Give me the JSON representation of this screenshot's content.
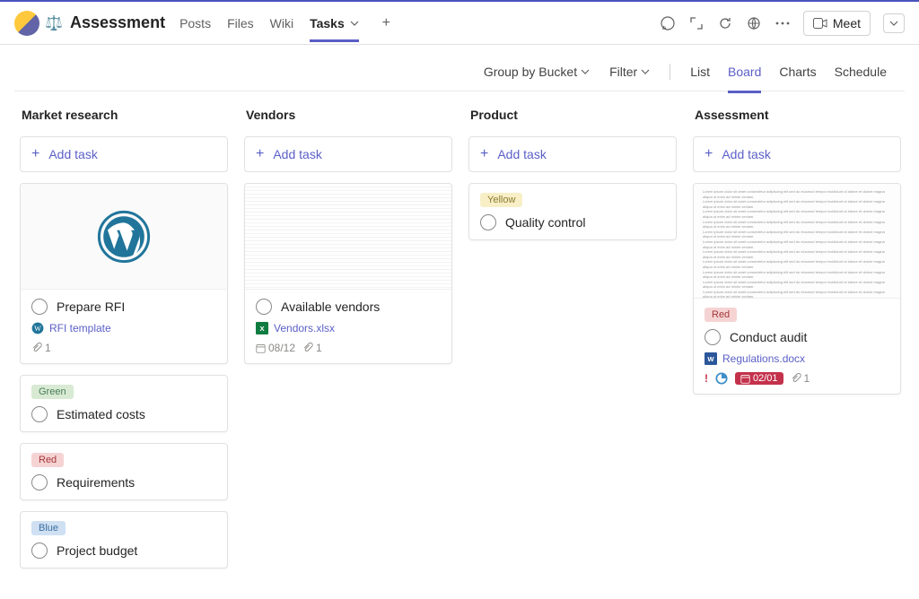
{
  "header": {
    "channel": "Assessment",
    "tabs": [
      "Posts",
      "Files",
      "Wiki",
      "Tasks"
    ],
    "active_tab": "Tasks",
    "meet_label": "Meet"
  },
  "toolbar": {
    "group_by": "Group by Bucket",
    "filter": "Filter",
    "views": [
      "List",
      "Board",
      "Charts",
      "Schedule"
    ],
    "active_view": "Board"
  },
  "columns": [
    {
      "name": "Market research",
      "add_label": "Add task",
      "cards": [
        {
          "type": "image",
          "title": "Prepare RFI",
          "attachment_name": "RFI template",
          "attachment_kind": "wordpress",
          "count": "1"
        },
        {
          "type": "label",
          "label": "Green",
          "label_class": "lbl-green",
          "title": "Estimated costs"
        },
        {
          "type": "label",
          "label": "Red",
          "label_class": "lbl-red",
          "title": "Requirements"
        },
        {
          "type": "label",
          "label": "Blue",
          "label_class": "lbl-blue",
          "title": "Project budget"
        }
      ]
    },
    {
      "name": "Vendors",
      "add_label": "Add task",
      "cards": [
        {
          "type": "placeholder",
          "title": "Available vendors",
          "attachment_name": "Vendors.xlsx",
          "attachment_kind": "excel",
          "due": "08/12",
          "count": "1"
        }
      ]
    },
    {
      "name": "Product",
      "add_label": "Add task",
      "cards": [
        {
          "type": "label",
          "label": "Yellow",
          "label_class": "lbl-yellow",
          "title": "Quality control"
        }
      ]
    },
    {
      "name": "Assessment",
      "add_label": "Add task",
      "cards": [
        {
          "type": "doc",
          "label": "Red",
          "label_class": "lbl-red",
          "title": "Conduct audit",
          "attachment_name": "Regulations.docx",
          "attachment_kind": "word",
          "priority": "!",
          "due": "02/01",
          "count": "1"
        }
      ]
    }
  ]
}
